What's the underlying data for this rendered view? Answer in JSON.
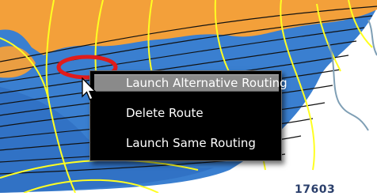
{
  "context_menu": {
    "items": [
      {
        "label": "Launch Alternative Routing",
        "highlighted": true
      },
      {
        "label": "Delete Route",
        "highlighted": false
      },
      {
        "label": "Launch Same Routing",
        "highlighted": false
      }
    ]
  },
  "map": {
    "corner_label": "17603",
    "colors": {
      "water": "#3a7fd0",
      "land": "#f3a03a",
      "grid_lines": "#ffff22",
      "route_lines": "#111111",
      "marker": "#e01b1b",
      "border": "#7f9fb5"
    }
  },
  "icons": {
    "cursor": "arrow-cursor-icon",
    "marker": "route-highlight-ring-icon"
  }
}
